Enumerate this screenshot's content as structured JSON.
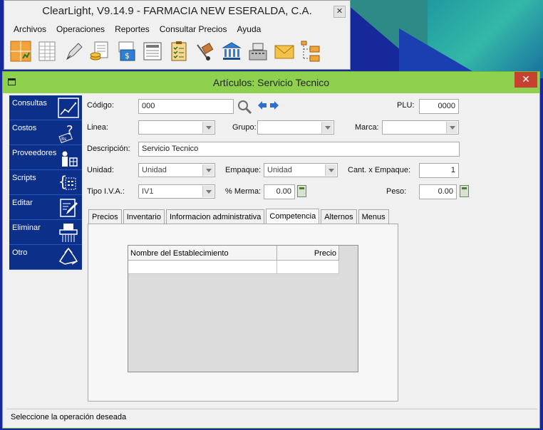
{
  "main_window": {
    "title": "ClearLight, V9.14.9 - FARMACIA NEW ESERALDA, C.A.",
    "close_glyph": "✕",
    "menu": [
      "Archivos",
      "Operaciones",
      "Reportes",
      "Consultar Precios",
      "Ayuda"
    ],
    "toolbar_icons": [
      "grid-chart-icon",
      "spreadsheet-icon",
      "pen-icon",
      "coins-document-icon",
      "money-document-icon",
      "report-icon",
      "checklist-icon",
      "hand-truck-icon",
      "bank-icon",
      "cash-register-icon",
      "envelope-icon",
      "folder-tree-icon"
    ]
  },
  "child_window": {
    "title": "Artículos: Servicio Tecnico",
    "close_glyph": "✕"
  },
  "sidebar": {
    "items": [
      {
        "label": "Consultas",
        "icon": "chart-icon"
      },
      {
        "label": "Costos",
        "icon": "price-tag-question-icon"
      },
      {
        "label": "Proveedores",
        "icon": "supplier-icon"
      },
      {
        "label": "Scripts",
        "icon": "script-braces-icon"
      },
      {
        "label": "Editar",
        "icon": "edit-document-icon"
      },
      {
        "label": "Eliminar",
        "icon": "shredder-icon"
      },
      {
        "label": "Otro",
        "icon": "recycle-icon"
      }
    ]
  },
  "form": {
    "codigo": {
      "label": "Código:",
      "value": "000"
    },
    "plu": {
      "label": "PLU:",
      "value": "0000"
    },
    "linea": {
      "label": "Linea:",
      "value": ""
    },
    "grupo": {
      "label": "Grupo:",
      "value": ""
    },
    "marca": {
      "label": "Marca:",
      "value": ""
    },
    "descripcion": {
      "label": "Descripción:",
      "value": "Servicio Tecnico"
    },
    "unidad": {
      "label": "Unidad:",
      "value": "Unidad"
    },
    "empaque": {
      "label": "Empaque:",
      "value": "Unidad"
    },
    "cant_empaque": {
      "label": "Cant. x Empaque:",
      "value": "1"
    },
    "tipo_iva": {
      "label": "Tipo I.V.A.:",
      "value": "IV1"
    },
    "merma": {
      "label": "% Merma:",
      "value": "0.00"
    },
    "peso": {
      "label": "Peso:",
      "value": "0.00"
    }
  },
  "tabs": [
    {
      "label": "Precios",
      "active": false
    },
    {
      "label": "Inventario",
      "active": false
    },
    {
      "label": "Informacion administrativa",
      "active": false
    },
    {
      "label": "Competencia",
      "active": true
    },
    {
      "label": "Alternos",
      "active": false
    },
    {
      "label": "Menus",
      "active": false
    }
  ],
  "competencia_grid": {
    "columns": [
      "Nombre del Establecimiento",
      "Precio"
    ]
  },
  "status": {
    "text": "Seleccione la operación deseada"
  },
  "colors": {
    "child_titlebar": "#8fd14f",
    "sidebar_bg": "#0c2f8a",
    "close_red": "#c8402f",
    "nav_arrow_blue": "#2b6fd6"
  }
}
